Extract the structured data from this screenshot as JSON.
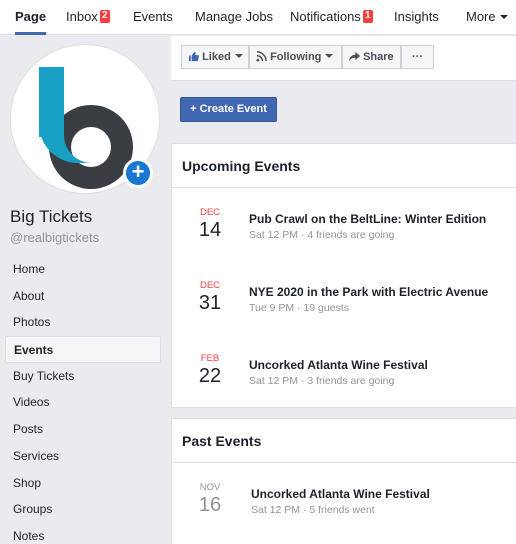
{
  "topnav": {
    "tabs": [
      {
        "label": "Page",
        "active": true
      },
      {
        "label": "Inbox",
        "badge": "2"
      },
      {
        "label": "Events"
      },
      {
        "label": "Manage Jobs"
      },
      {
        "label": "Notifications",
        "badge": "1"
      },
      {
        "label": "Insights"
      },
      {
        "label": "More"
      }
    ]
  },
  "colors": {
    "accent": "#4267b2",
    "badge": "#fa3e3e",
    "logo_blue": "#17a0c4",
    "logo_dark": "#3a3d42",
    "add_photo": "#1877d2"
  },
  "sidebar": {
    "page_name": "Big Tickets",
    "handle": "@realbigtickets",
    "items": [
      {
        "label": "Home"
      },
      {
        "label": "About"
      },
      {
        "label": "Photos"
      },
      {
        "label": "Events",
        "active": true
      },
      {
        "label": "Buy Tickets"
      },
      {
        "label": "Videos"
      },
      {
        "label": "Posts"
      },
      {
        "label": "Services"
      },
      {
        "label": "Shop"
      },
      {
        "label": "Groups"
      },
      {
        "label": "Notes"
      }
    ]
  },
  "toolbar": {
    "liked": "Liked",
    "following": "Following",
    "share": "Share",
    "more": "···"
  },
  "create_event": "+ Create Event",
  "upcoming": {
    "title": "Upcoming Events",
    "events": [
      {
        "month": "DEC",
        "day": "14",
        "title": "Pub Crawl on the BeltLine: Winter Edition",
        "meta": "Sat 12 PM · 4 friends are going"
      },
      {
        "month": "DEC",
        "day": "31",
        "title": "NYE 2020 in the Park with Electric Avenue",
        "meta": "Tue 9 PM · 19 guests"
      },
      {
        "month": "FEB",
        "day": "22",
        "title": "Uncorked Atlanta Wine Festival",
        "meta": "Sat 12 PM · 3 friends are going"
      }
    ]
  },
  "past": {
    "title": "Past Events",
    "events": [
      {
        "month": "NOV",
        "day": "16",
        "title": "Uncorked Atlanta Wine Festival",
        "meta": "Sat 12 PM · 5 friends went"
      }
    ]
  }
}
